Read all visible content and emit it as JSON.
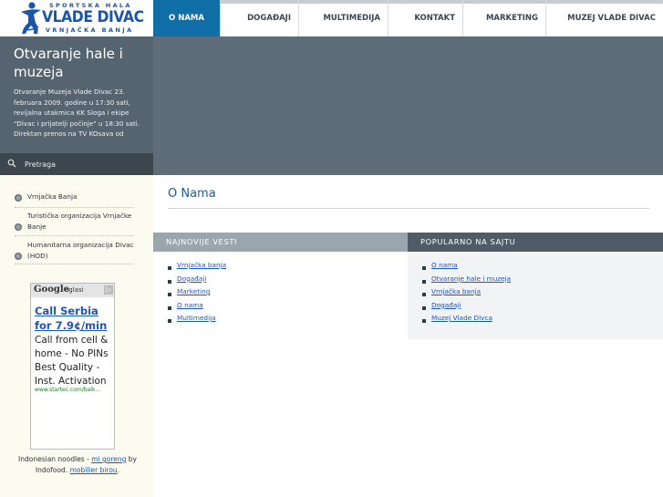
{
  "logo": {
    "line1": "SPORTSKA HALA",
    "line2": "VLADE DIVAC",
    "line3": "VRNJAČKA BANJA"
  },
  "nav": [
    {
      "label": "O NAMA",
      "active": true
    },
    {
      "label": "DOGAĐAJI"
    },
    {
      "label": "MULTIMEDIJA"
    },
    {
      "label": "KONTAKT"
    },
    {
      "label": "MARKETING"
    },
    {
      "label": "MUZEJ VLADE DIVAC"
    }
  ],
  "hero": {
    "title": "Otvaranje hale i muzeja",
    "text": "Otvaranje Muzeja Vlade Divac 23. februara 2009. godine u 17:30 sati, revijalna utakmica KK Sloga i ekipe \"Divac i prijatelji počinje\" u 18:30 sati. Direktan prenos na TV KOsava od"
  },
  "search": {
    "placeholder": "Pretraga"
  },
  "sidebar": {
    "items": [
      {
        "label": "Vrnjačka Banja"
      },
      {
        "label": "Turistička organizacija Vrnjačke Banje"
      },
      {
        "label": "Humanitarna organizacija Divac (HOD)"
      }
    ],
    "ad": {
      "brand": "Google",
      "suffix": "oglasi",
      "close": "▷",
      "title": "Call Serbia for 7.9¢/min",
      "body": "Call from cell & home - No PINs Best Quality - Inst. Activation",
      "url": "www.startec.com/balk..."
    },
    "footer": {
      "text1": "Indonesian noodles - ",
      "link1": "mi goreng",
      "text2": " by Indofood. ",
      "link2": "mobilier birou",
      "text3": "."
    }
  },
  "main": {
    "title": "O Nama",
    "latest": {
      "heading": "NAJNOVIJE VESTI",
      "items": [
        "Vrnjačka banja",
        "Događaji",
        "Marketing",
        "O nama",
        "Multimedija"
      ]
    },
    "popular": {
      "heading": "POPULARNO NA SAJTU",
      "items": [
        "O nama",
        "Otvaranje hale i muzeja",
        "Vrnjačka banja",
        "Događaji",
        "Muzej Vlade Divca"
      ]
    }
  },
  "colors": {
    "nav_active": "#0f6fa6",
    "hero_bg": "#56646f",
    "banner_bg": "#5f6d79",
    "link": "#1a55c5",
    "logo_blue": "#1a56a8"
  },
  "icons": {
    "logo": "player-silhouette-icon",
    "search": "magnifier-icon",
    "sidebar_bullet": "circle-bullet-icon"
  }
}
